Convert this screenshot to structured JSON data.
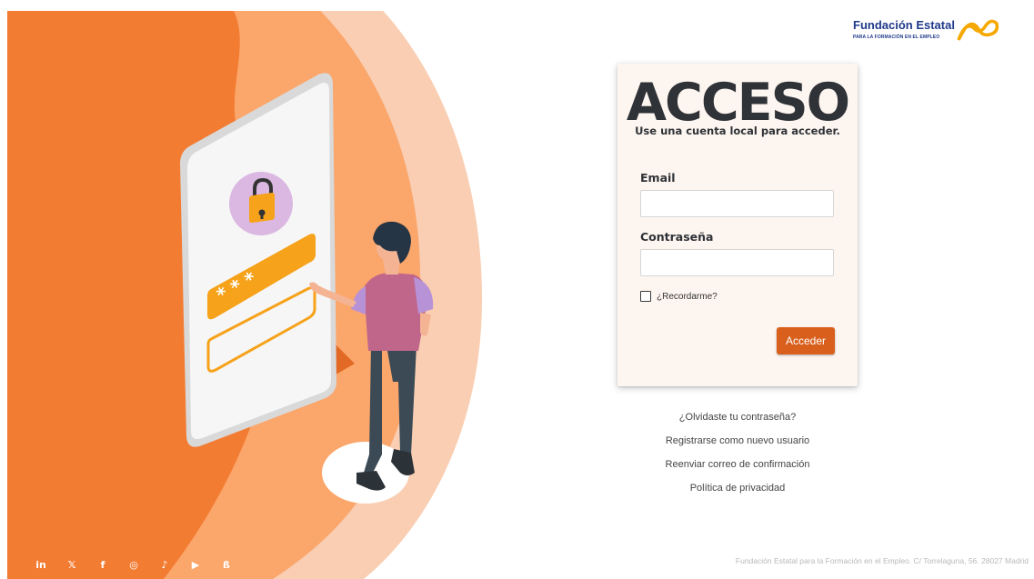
{
  "brand": {
    "name": "Fundación Estatal",
    "tagline": "PARA LA FORMACIÓN EN EL EMPLEO",
    "color": "#1f3a8a",
    "accent": "#f5a800"
  },
  "login": {
    "title": "ACCESO",
    "subtitle": "Use una cuenta local para acceder.",
    "email_label": "Email",
    "email_value": "",
    "password_label": "Contraseña",
    "password_value": "",
    "remember_label": "¿Recordarme?",
    "remember_checked": false,
    "submit_label": "Acceder",
    "submit_color": "#d9601c"
  },
  "links": {
    "forgot_password": "¿Olvidaste tu contraseña?",
    "register": "Registrarse como nuevo usuario",
    "resend_confirmation": "Reenviar correo de confirmación",
    "privacy_policy": "Política de privacidad"
  },
  "footer": {
    "address": "Fundación Estatal para la Formación en el Empleo. C/ Torrelaguna, 56. 28027 Madrid",
    "social_icons": [
      "linkedin-icon",
      "x-icon",
      "facebook-icon",
      "instagram-icon",
      "tiktok-icon",
      "youtube-icon",
      "bluesky-icon"
    ],
    "social_glyphs": {
      "linkedin": "in",
      "x": "𝕏",
      "facebook": "f",
      "instagram": "◎",
      "tiktok": "♪",
      "youtube": "▶",
      "bluesky": "ß"
    }
  },
  "illustration": {
    "colors": {
      "outer_ring": "#f9ceb2",
      "middle_ring": "#fba66b",
      "inner_blob": "#f37c33",
      "accent": "#f6a21a",
      "lock_circle": "#dab8e2"
    },
    "password_mask": "*   *   *"
  }
}
